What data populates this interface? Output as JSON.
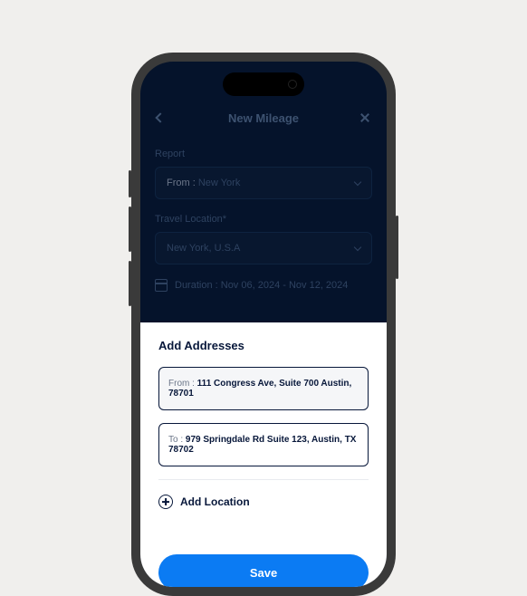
{
  "header": {
    "title": "New Mileage"
  },
  "form": {
    "report_label": "Report",
    "report_prefix": "From : ",
    "report_value": "New York",
    "travel_label": "Travel Location*",
    "travel_value": "New York, U.S.A",
    "duration_label": "Duration : ",
    "duration_value": "Nov 06, 2024 - Nov 12, 2024"
  },
  "sheet": {
    "title": "Add Addresses",
    "from_prefix": "From : ",
    "from_value": "111 Congress Ave, Suite 700 Austin, 78701",
    "to_prefix": "To : ",
    "to_value": "979 Springdale Rd Suite 123, Austin, TX 78702",
    "add_location_label": "Add Location",
    "save_label": "Save"
  }
}
